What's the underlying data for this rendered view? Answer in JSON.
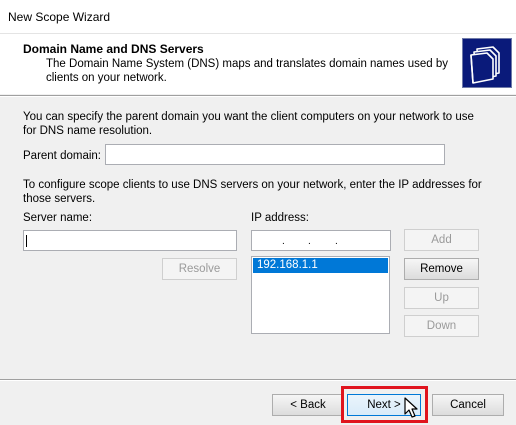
{
  "window": {
    "title": "New Scope Wizard"
  },
  "header": {
    "title": "Domain Name and DNS Servers",
    "subtitle": "The Domain Name System (DNS) maps and translates domain names used by clients on your network."
  },
  "parent_domain": {
    "description": "You can specify the parent domain you want the client computers on your network to use for DNS name resolution.",
    "label": "Parent domain:",
    "value": ""
  },
  "dns_servers": {
    "description": "To configure scope clients to use DNS servers on your network, enter the IP addresses for those servers.",
    "server_name_label": "Server name:",
    "server_name_value": "",
    "ip_address_label": "IP address:",
    "ip_list": [
      "192.168.1.1"
    ],
    "selected_ip_index": 0,
    "buttons": {
      "resolve": "Resolve",
      "add": "Add",
      "remove": "Remove",
      "up": "Up",
      "down": "Down"
    }
  },
  "footer": {
    "back": "< Back",
    "next": "Next >",
    "cancel": "Cancel"
  },
  "colors": {
    "selection": "#0078d7",
    "highlight_box": "#e0141e"
  },
  "icons": {
    "wizard_header": "folders-icon",
    "cursor": "mouse-pointer-icon"
  }
}
